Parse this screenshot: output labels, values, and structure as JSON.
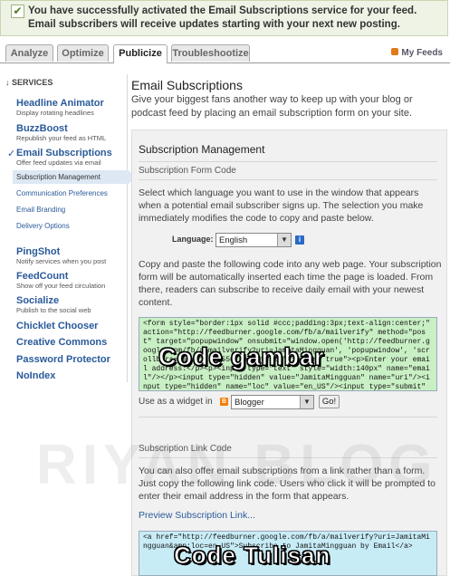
{
  "notice": {
    "message": "You have successfully activated the Email Subscriptions service for your feed. Email subscribers will receive updates starting with your next new posting."
  },
  "tabs": [
    {
      "label": "Analyze"
    },
    {
      "label": "Optimize"
    },
    {
      "label": "Publicize"
    },
    {
      "label": "Troubleshootize"
    }
  ],
  "my_feeds": "My Feeds",
  "sidebar": {
    "heading": "SERVICES",
    "items": [
      {
        "label": "Headline Animator",
        "desc": "Display rotating headlines"
      },
      {
        "label": "BuzzBoost",
        "desc": "Republish your feed as HTML"
      },
      {
        "label": "Email Subscriptions",
        "desc": "Offer feed updates via email"
      },
      {
        "label": "PingShot",
        "desc": "Notify services when you post"
      },
      {
        "label": "FeedCount",
        "desc": "Show off your feed circulation"
      },
      {
        "label": "Socialize",
        "desc": "Publish to the social web"
      },
      {
        "label": "Chicklet Chooser"
      },
      {
        "label": "Creative Commons"
      },
      {
        "label": "Password Protector"
      },
      {
        "label": "NoIndex"
      }
    ],
    "subitems": [
      {
        "label": "Subscription Management"
      },
      {
        "label": "Communication Preferences"
      },
      {
        "label": "Email Branding"
      },
      {
        "label": "Delivery Options"
      }
    ]
  },
  "main": {
    "title": "Email Subscriptions",
    "intro": "Give your biggest fans another way to keep up with your blog or podcast feed by placing an email subscription form on your site.",
    "panel_title": "Subscription Management",
    "form_code_heading": "Subscription Form Code",
    "language_text": "Select which language you want to use in the window that appears when a potential email subscriber signs up. The selection you make immediately modifies the code to copy and paste below.",
    "language_label": "Language:",
    "language_value": "English",
    "paste_text": "Copy and paste the following code into any web page. Your subscription form will be automatically inserted each time the page is loaded. From there, readers can subscribe to receive daily email with your newest content.",
    "form_code": "<form style=\"border:1px solid #ccc;padding:3px;text-align:center;\" action=\"http://feedburner.google.com/fb/a/mailverify\" method=\"post\" target=\"popupwindow\" onsubmit=\"window.open('http://feedburner.google.com/fb/a/mailverify?uri=JamitaMingguan', 'popupwindow', 'scrollbars=yes,width=550,height=520');return true\"><p>Enter your email address:</p><p><input type=\"text\" style=\"width:140px\" name=\"email\"/></p><input type=\"hidden\" value=\"JamitaMingguan\" name=\"uri\"/><input type=\"hidden\" name=\"loc\" value=\"en_US\"/><input type=\"submit\"",
    "widget_label": "Use as a widget in",
    "widget_value": "Blogger",
    "go_label": "Go!",
    "link_code_heading": "Subscription Link Code",
    "link_text": "You can also offer email subscriptions from a link rather than a form. Just copy the following link code. Users who click it will be prompted to enter their email address in the form that appears.",
    "preview_link": "Preview Subscription Link...",
    "link_code": "<a href=\"http://feedburner.google.com/fb/a/mailverify?uri=JamitaMingguan&amp;loc=en_US\">Subscribe to JamitaMingguan by Email</a>"
  },
  "overlays": {
    "code_gambar": "Code gambar",
    "code_tulisan": "Code Tulisan",
    "watermark": "RIYAN BLOG"
  },
  "colors": {
    "form_code_bg": "#c9efc4",
    "link_code_bg": "#c8ecf6",
    "link_color": "#2a5a9a",
    "notice_bg": "#eef3e6"
  }
}
